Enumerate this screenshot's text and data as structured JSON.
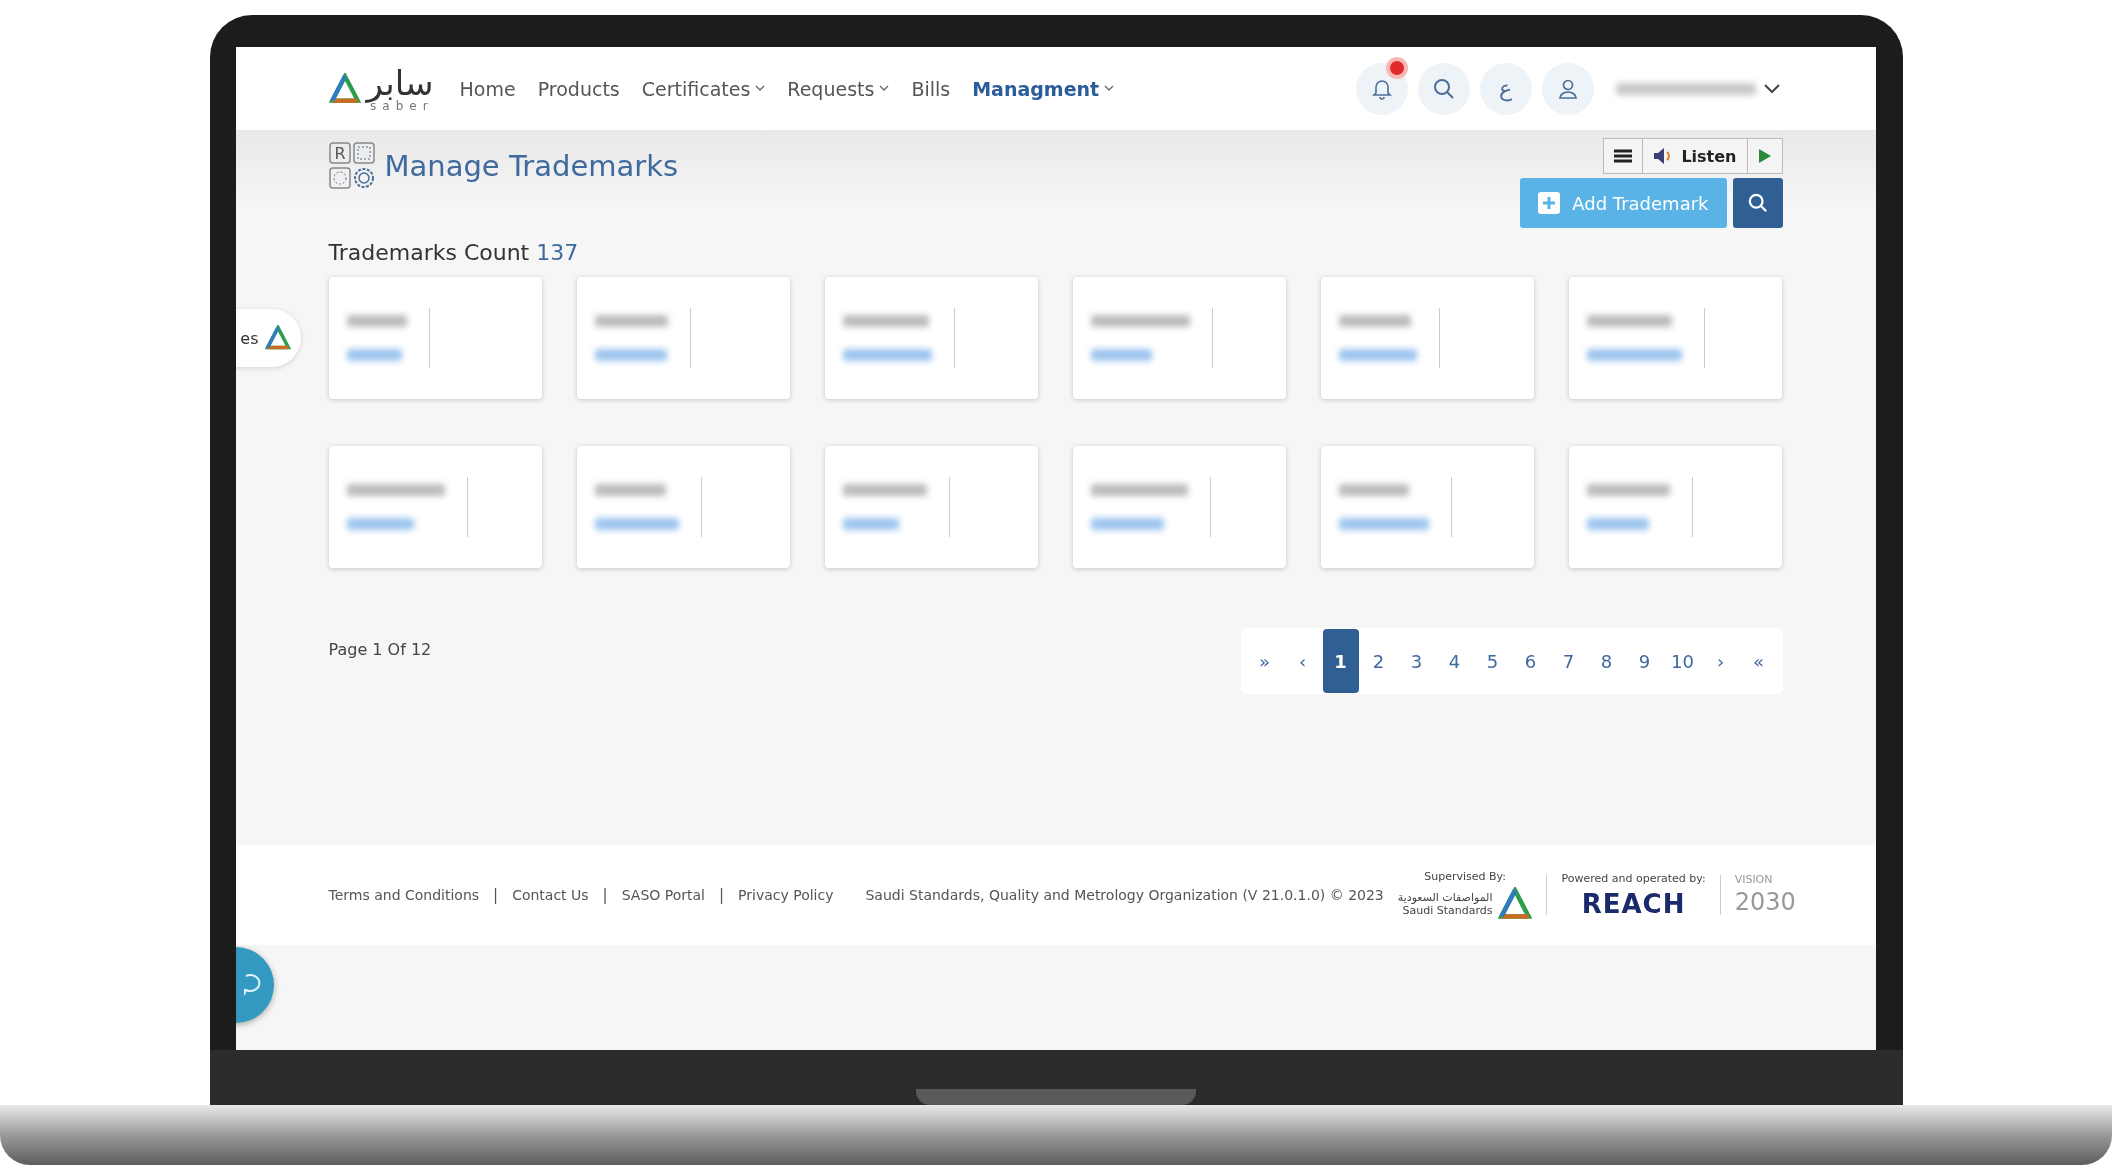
{
  "header": {
    "logo": {
      "arabic": "سابر",
      "latin": "saber"
    },
    "nav": [
      {
        "label": "Home",
        "dropdown": false,
        "selected": false
      },
      {
        "label": "Products",
        "dropdown": false,
        "selected": false
      },
      {
        "label": "Certificates",
        "dropdown": true,
        "selected": false
      },
      {
        "label": "Requests",
        "dropdown": true,
        "selected": false
      },
      {
        "label": "Bills",
        "dropdown": false,
        "selected": false
      },
      {
        "label": "Managment",
        "dropdown": true,
        "selected": true
      }
    ],
    "notifications": {
      "unread": true
    },
    "language": "ع",
    "user": {
      "name_blurred": true
    }
  },
  "side_tab": {
    "label": "es"
  },
  "listen_toolbar": {
    "label": "Listen"
  },
  "page": {
    "icon_letter": "R",
    "title": "Manage Trademarks",
    "add_button": "Add Trademark",
    "count_label": "Trademarks Count",
    "count": "137"
  },
  "cards": [
    {
      "blurred": true
    },
    {
      "blurred": true
    },
    {
      "blurred": true
    },
    {
      "blurred": true
    },
    {
      "blurred": true
    },
    {
      "blurred": true
    },
    {
      "blurred": true
    },
    {
      "blurred": true
    },
    {
      "blurred": true
    },
    {
      "blurred": true
    },
    {
      "blurred": true
    },
    {
      "blurred": true
    }
  ],
  "pagination": {
    "summary": "Page 1 Of 12",
    "first": "»",
    "prev": "‹",
    "next": "›",
    "last": "«",
    "pages": [
      {
        "label": "1",
        "selected": true
      },
      {
        "label": "2",
        "selected": false
      },
      {
        "label": "3",
        "selected": false
      },
      {
        "label": "4",
        "selected": false
      },
      {
        "label": "5",
        "selected": false
      },
      {
        "label": "6",
        "selected": false
      },
      {
        "label": "7",
        "selected": false
      },
      {
        "label": "8",
        "selected": false
      },
      {
        "label": "9",
        "selected": false
      },
      {
        "label": "10",
        "selected": false
      }
    ]
  },
  "footer": {
    "links": [
      "Terms and Conditions",
      "Contact Us",
      "SASO Portal",
      "Privacy Policy"
    ],
    "separator": "|",
    "copyright": "Saudi Standards, Quality and Metrology Organization (V 21.0.1.0) © 2023",
    "supervised_label": "Supervised By:",
    "saso_arabic": "المواصفات السعودية",
    "saso_english": "Saudi Standards",
    "powered_label": "Powered and operated by:",
    "reach": "REACH",
    "vision_label": "VISION",
    "vision_year": "2030"
  }
}
